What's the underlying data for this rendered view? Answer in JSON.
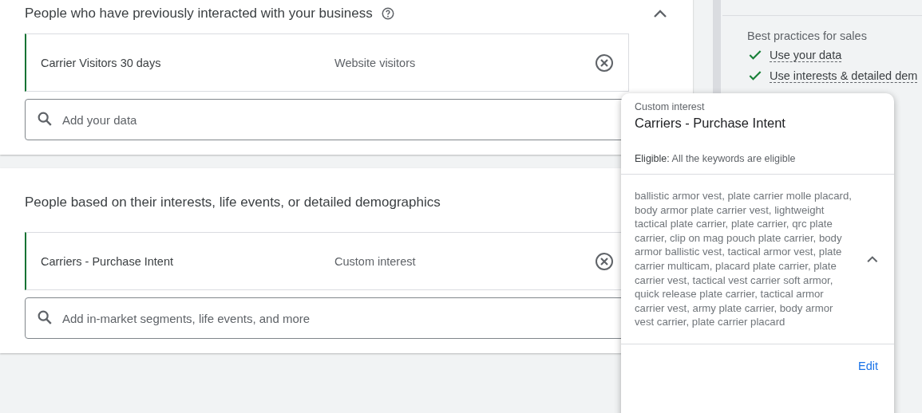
{
  "sections": [
    {
      "title": "People who have previously interacted with your business",
      "help": true,
      "expanded": true,
      "items": [
        {
          "name": "Carrier Visitors 30 days",
          "type": "Website visitors"
        }
      ],
      "search": {
        "placeholder": "Add your data"
      }
    },
    {
      "title": "People based on their interests, life events, or detailed demographics",
      "items": [
        {
          "name": "Carriers - Purchase Intent",
          "type": "Custom interest"
        }
      ],
      "search": {
        "placeholder": "Add in-market segments, life events, and more"
      }
    }
  ],
  "side": {
    "heading": "Best practices for sales",
    "items": [
      {
        "label": "Use your data",
        "checked": true
      },
      {
        "label": "Use interests & detailed dem",
        "checked": true
      }
    ]
  },
  "popup": {
    "kind": "Custom interest",
    "title": "Carriers - Purchase Intent",
    "status_label": "Eligible:",
    "status": "All the keywords are eligible",
    "keywords": "ballistic armor vest, plate carrier molle placard, body armor plate carrier vest, lightweight tactical plate carrier, plate carrier, qrc plate carrier, clip on mag pouch plate carrier, body armor ballistic vest, tactical armor vest, plate carrier multicam, placard plate carrier, plate carrier vest, tactical vest carrier soft armor, quick release plate carrier, tactical armor carrier vest, army plate carrier, body armor vest carrier, plate carrier placard",
    "expanded": true,
    "action": "Edit"
  }
}
